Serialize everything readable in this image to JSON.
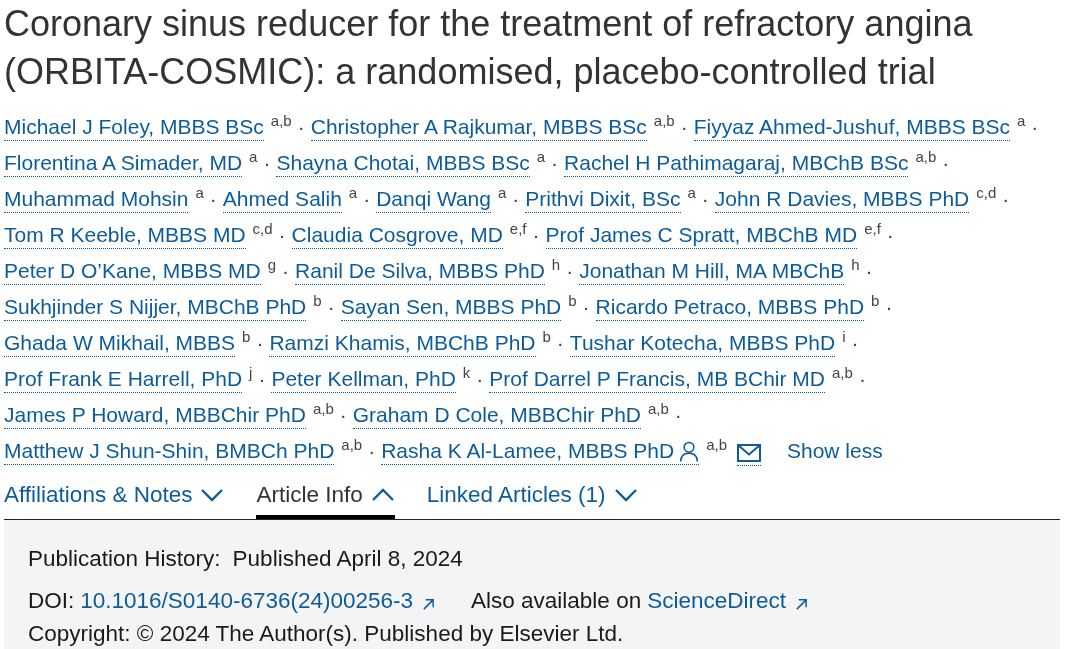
{
  "title": "Coronary sinus reducer for the treatment of refractory angina (ORBITA-COSMIC): a randomised, placebo-controlled trial",
  "author_rows": [
    [
      {
        "name": "Michael J Foley, MBBS BSc",
        "affiliations": "a,b",
        "separator": "·",
        "corresponding": false
      },
      {
        "name": "Christopher A Rajkumar, MBBS BSc",
        "affiliations": "a,b",
        "separator": "·",
        "corresponding": false
      },
      {
        "name": "Fiyyaz Ahmed-Jushuf, MBBS BSc",
        "affiliations": "a",
        "separator": "·",
        "corresponding": false
      }
    ],
    [
      {
        "name": "Florentina A Simader, MD",
        "affiliations": "a",
        "separator": "·",
        "corresponding": false
      },
      {
        "name": "Shayna Chotai, MBBS BSc",
        "affiliations": "a",
        "separator": "·",
        "corresponding": false
      },
      {
        "name": "Rachel H Pathimagaraj, MBChB BSc",
        "affiliations": "a,b",
        "separator": "·",
        "corresponding": false
      }
    ],
    [
      {
        "name": "Muhammad Mohsin",
        "affiliations": "a",
        "separator": "·",
        "corresponding": false
      },
      {
        "name": "Ahmed Salih",
        "affiliations": "a",
        "separator": "·",
        "corresponding": false
      },
      {
        "name": "Danqi Wang",
        "affiliations": "a",
        "separator": "·",
        "corresponding": false
      },
      {
        "name": "Prithvi Dixit, BSc",
        "affiliations": "a",
        "separator": "·",
        "corresponding": false
      },
      {
        "name": "John R Davies, MBBS PhD",
        "affiliations": "c,d",
        "separator": "·",
        "corresponding": false
      }
    ],
    [
      {
        "name": "Tom R Keeble, MBBS MD",
        "affiliations": "c,d",
        "separator": "·",
        "corresponding": false
      },
      {
        "name": "Claudia Cosgrove, MD",
        "affiliations": "e,f",
        "separator": "·",
        "corresponding": false
      },
      {
        "name": "Prof James C Spratt, MBChB MD",
        "affiliations": "e,f",
        "separator": "·",
        "corresponding": false
      }
    ],
    [
      {
        "name": "Peter D O’Kane, MBBS MD",
        "affiliations": "g",
        "separator": "·",
        "corresponding": false
      },
      {
        "name": "Ranil De Silva, MBBS PhD",
        "affiliations": "h",
        "separator": "·",
        "corresponding": false
      },
      {
        "name": "Jonathan M Hill, MA MBChB",
        "affiliations": "h",
        "separator": "·",
        "corresponding": false
      }
    ],
    [
      {
        "name": "Sukhjinder S Nijjer, MBChB PhD",
        "affiliations": "b",
        "separator": "·",
        "corresponding": false
      },
      {
        "name": "Sayan Sen, MBBS PhD",
        "affiliations": "b",
        "separator": "·",
        "corresponding": false
      },
      {
        "name": "Ricardo Petraco, MBBS PhD",
        "affiliations": "b",
        "separator": "·",
        "corresponding": false
      }
    ],
    [
      {
        "name": "Ghada W Mikhail, MBBS",
        "affiliations": "b",
        "separator": "·",
        "corresponding": false
      },
      {
        "name": "Ramzi Khamis, MBChB PhD",
        "affiliations": "b",
        "separator": "·",
        "corresponding": false
      },
      {
        "name": "Tushar Kotecha, MBBS PhD",
        "affiliations": "i",
        "separator": "·",
        "corresponding": false
      }
    ],
    [
      {
        "name": "Prof Frank E Harrell, PhD",
        "affiliations": "j",
        "separator": "·",
        "corresponding": false
      },
      {
        "name": "Peter Kellman, PhD",
        "affiliations": "k",
        "separator": "·",
        "corresponding": false
      },
      {
        "name": "Prof Darrel P Francis, MB BChir MD",
        "affiliations": "a,b",
        "separator": "·",
        "corresponding": false
      }
    ],
    [
      {
        "name": "James P Howard, MBBChir PhD",
        "affiliations": "a,b",
        "separator": "·",
        "corresponding": false
      },
      {
        "name": "Graham D Cole, MBBChir PhD",
        "affiliations": "a,b",
        "separator": "·",
        "corresponding": false
      }
    ],
    [
      {
        "name": "Matthew J Shun-Shin, BMBCh PhD",
        "affiliations": "a,b",
        "separator": "·",
        "corresponding": false
      },
      {
        "name": "Rasha K Al-Lamee, MBBS PhD",
        "affiliations": "a,b",
        "corresponding": true
      }
    ]
  ],
  "authors_toggle": "Show less",
  "tabs": [
    {
      "label": "Affiliations & Notes",
      "selected": false
    },
    {
      "label": "Article Info",
      "selected": true
    },
    {
      "label": "Linked Articles (1)",
      "selected": false
    }
  ],
  "article_info": {
    "publication_history": {
      "label": "Publication History:",
      "value": "Published April 8, 2024"
    },
    "doi": {
      "label": "DOI:",
      "value": "10.1016/S0140-6736(24)00256-3"
    },
    "also_available": {
      "label": "Also available on",
      "value": "ScienceDirect"
    },
    "copyright": "Copyright: © 2024 The Author(s). Published by Elsevier Ltd."
  }
}
